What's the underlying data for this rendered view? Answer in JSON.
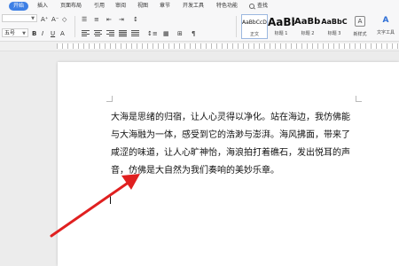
{
  "menu": {
    "tabs": [
      "开始",
      "插入",
      "页面布局",
      "引用",
      "审阅",
      "视图",
      "章节",
      "开发工具",
      "特色功能"
    ],
    "active_tab": "开始",
    "search_label": "查找"
  },
  "ribbon": {
    "font_name": "",
    "font_size": "五号",
    "style_gallery": [
      {
        "preview": "AaBbCcDd",
        "label": "正文"
      },
      {
        "preview": "AaBb",
        "label": "标题 1"
      },
      {
        "preview": "AaBb(",
        "label": "标题 2"
      },
      {
        "preview": "AaBbC",
        "label": "标题 3"
      }
    ],
    "new_style_label": "新样式",
    "text_tool_label": "文字工具",
    "accent_color": "#3d7fe5"
  },
  "document": {
    "paragraph": "大海是思绪的归宿，让人心灵得以净化。站在海边，我仿佛能与大海融为一体，感受到它的浩渺与澎湃。海风拂面，带来了咸涩的味道，让人心旷神怡，海浪拍打着礁石，发出悦耳的声音，仿佛是大自然为我们奏响的美妙乐章。"
  },
  "annotation": {
    "arrow_color": "#e02020"
  }
}
